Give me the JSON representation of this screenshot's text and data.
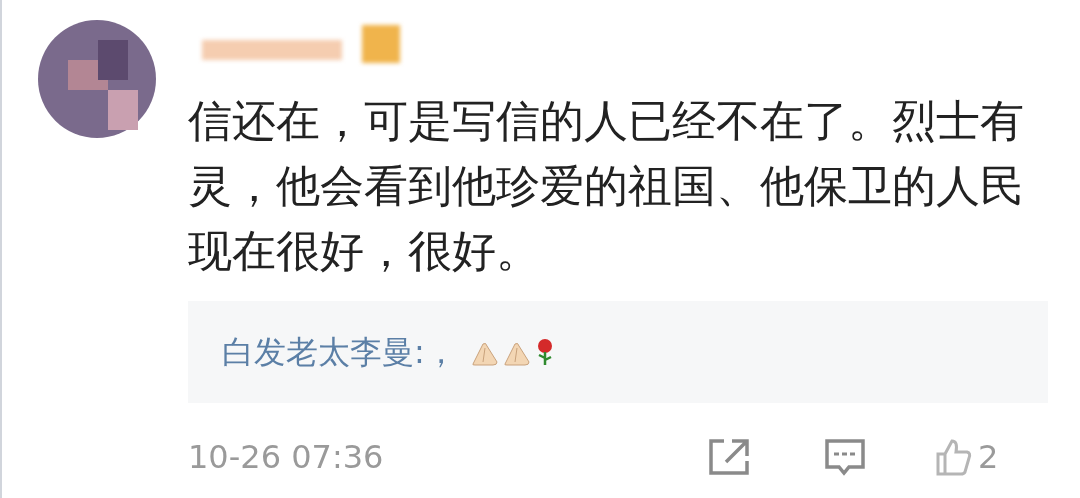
{
  "comment": {
    "text": "信还在，可是写信的人已经不在了。烈士有灵，他会看到他珍爱的祖国、他保卫的人民现在很好，很好。",
    "reply": {
      "author": "白发老太李曼",
      "text": ":，"
    },
    "time": "10-26 07:36",
    "like_count": "2"
  }
}
